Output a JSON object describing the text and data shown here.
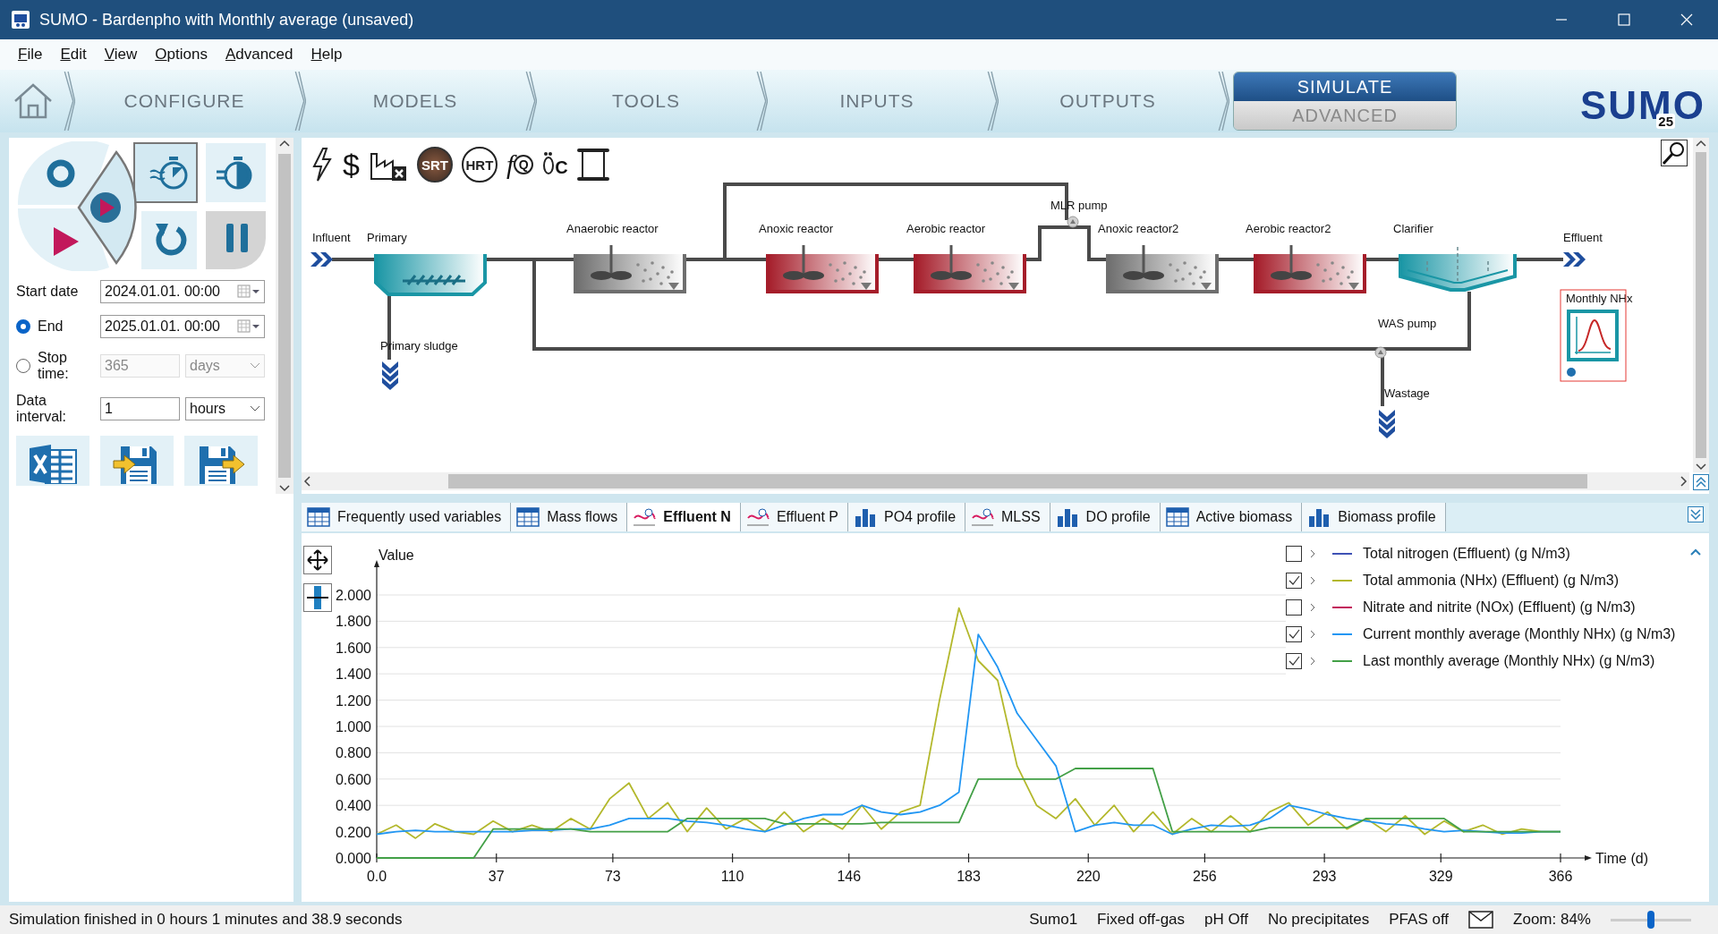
{
  "window": {
    "title": "SUMO - Bardenpho with Monthly average (unsaved)"
  },
  "menu": [
    "File",
    "Edit",
    "View",
    "Options",
    "Advanced",
    "Help"
  ],
  "nav": [
    {
      "label": "CONFIGURE",
      "selected": false
    },
    {
      "label": "MODELS",
      "selected": false
    },
    {
      "label": "TOOLS",
      "selected": false
    },
    {
      "label": "INPUTS",
      "selected": false
    },
    {
      "label": "OUTPUTS",
      "selected": false
    }
  ],
  "nav_split": [
    {
      "label": "SIMULATE",
      "selected": true
    },
    {
      "label": "ADVANCED",
      "selected": false
    }
  ],
  "logo": {
    "text": "SUMO",
    "badge": "25"
  },
  "run_panel": {
    "start_date": {
      "label": "Start date",
      "value": "2024.01.01. 00:00"
    },
    "end": {
      "label": "End",
      "value": "2025.01.01. 00:00",
      "selected": true
    },
    "stop_time": {
      "label": "Stop time:",
      "value": "365",
      "unit": "days",
      "selected": false
    },
    "data_interval": {
      "label": "Data interval:",
      "value": "1",
      "unit": "hours"
    }
  },
  "diagram_toolbar": [
    {
      "kind": "power"
    },
    {
      "kind": "text",
      "text": "$"
    },
    {
      "kind": "emissions"
    },
    {
      "kind": "badge",
      "text": "SRT",
      "dark": true
    },
    {
      "kind": "badge",
      "text": "HRT",
      "dark": false
    },
    {
      "kind": "function",
      "text": "f",
      "sub": "Q"
    },
    {
      "kind": "footprint",
      "text": "C"
    },
    {
      "kind": "scroll"
    }
  ],
  "diagram": {
    "elements": [
      {
        "kind": "influent",
        "label": "Influent"
      },
      {
        "kind": "primary",
        "label": "Primary"
      },
      {
        "kind": "outlet",
        "label": "Primary sludge"
      },
      {
        "kind": "reactor",
        "label": "Anaerobic reactor",
        "color": "#6e6e6e"
      },
      {
        "kind": "reactor",
        "label": "Anoxic reactor",
        "color": "#a51d2a"
      },
      {
        "kind": "reactor",
        "label": "Aerobic reactor",
        "color": "#a51d2a"
      },
      {
        "kind": "pump",
        "label": "MLR pump"
      },
      {
        "kind": "reactor",
        "label": "Anoxic reactor2",
        "color": "#6e6e6e"
      },
      {
        "kind": "reactor",
        "label": "Aerobic reactor2",
        "color": "#a51d2a"
      },
      {
        "kind": "clarifier",
        "label": "Clarifier"
      },
      {
        "kind": "effluent",
        "label": "Effluent"
      },
      {
        "kind": "pump",
        "label": "WAS pump"
      },
      {
        "kind": "outlet",
        "label": "Wastage"
      },
      {
        "kind": "monitor",
        "label": "Monthly NHx",
        "selected": true
      }
    ]
  },
  "chart_tabs": [
    {
      "label": "Frequently used variables",
      "kind": "table",
      "selected": false
    },
    {
      "label": "Mass flows",
      "kind": "table",
      "selected": false
    },
    {
      "label": "Effluent N",
      "kind": "timeseries",
      "selected": true
    },
    {
      "label": "Effluent P",
      "kind": "timeseries",
      "selected": false
    },
    {
      "label": "PO4 profile",
      "kind": "bars",
      "selected": false
    },
    {
      "label": "MLSS",
      "kind": "timeseries",
      "selected": false
    },
    {
      "label": "DO profile",
      "kind": "bars",
      "selected": false
    },
    {
      "label": "Active biomass",
      "kind": "table",
      "selected": false
    },
    {
      "label": "Biomass profile",
      "kind": "bars",
      "selected": false
    }
  ],
  "chart_data": {
    "type": "line",
    "xlabel": "Time  (d)",
    "ylabel": "Value",
    "xlim": [
      0,
      366
    ],
    "ylim": [
      0,
      2
    ],
    "xticks": [
      {
        "value": 0,
        "label": "0.0"
      },
      37,
      73,
      110,
      146,
      183,
      220,
      256,
      293,
      329,
      366
    ],
    "yticks": [
      {
        "value": 0,
        "label": "0.000"
      },
      {
        "value": 0.2,
        "label": "0.200"
      },
      {
        "value": 0.4,
        "label": "0.400"
      },
      {
        "value": 0.6,
        "label": "0.600"
      },
      {
        "value": 0.8,
        "label": "0.800"
      },
      {
        "value": 1,
        "label": "1.000"
      },
      {
        "value": 1.2,
        "label": "1.200"
      },
      {
        "value": 1.4,
        "label": "1.400"
      },
      {
        "value": 1.6,
        "label": "1.600"
      },
      {
        "value": 1.8,
        "label": "1.800"
      },
      {
        "value": 2,
        "label": "2.000"
      }
    ],
    "x": [
      0,
      6,
      12,
      18,
      24,
      30,
      36,
      42,
      48,
      54,
      60,
      66,
      72,
      78,
      84,
      90,
      96,
      102,
      108,
      114,
      120,
      126,
      132,
      138,
      144,
      150,
      156,
      162,
      168,
      174,
      180,
      186,
      192,
      198,
      204,
      210,
      216,
      222,
      228,
      234,
      240,
      246,
      252,
      258,
      264,
      270,
      276,
      282,
      288,
      294,
      300,
      306,
      312,
      318,
      324,
      330,
      336,
      342,
      348,
      354,
      360,
      366
    ],
    "grid": true,
    "series": [
      {
        "name": "Total nitrogen (Effluent) (g N/m3)",
        "color": "#3f51b5",
        "values": [
          null,
          null,
          null,
          null,
          null,
          null,
          null,
          null,
          null,
          null,
          null,
          null,
          null,
          null,
          null,
          null,
          null,
          null,
          null,
          null,
          null,
          null,
          null,
          null,
          null,
          null,
          null,
          null,
          null,
          null,
          null,
          null,
          null,
          null,
          null,
          null,
          null,
          null,
          null,
          null,
          null,
          null,
          null,
          null,
          null,
          null,
          null,
          null,
          null,
          null,
          null,
          null,
          null,
          null,
          null,
          null,
          null,
          null,
          null,
          null,
          null,
          null
        ]
      },
      {
        "name": "Total ammonia (NHx) (Effluent) (g N/m3)",
        "color": "#b3b82c",
        "values": [
          0.18,
          0.25,
          0.15,
          0.26,
          0.2,
          0.18,
          0.28,
          0.2,
          0.25,
          0.2,
          0.3,
          0.22,
          0.45,
          0.57,
          0.3,
          0.42,
          0.2,
          0.38,
          0.22,
          0.3,
          0.2,
          0.35,
          0.2,
          0.3,
          0.22,
          0.4,
          0.22,
          0.35,
          0.4,
          1.2,
          1.9,
          1.5,
          1.35,
          0.7,
          0.4,
          0.3,
          0.45,
          0.25,
          0.4,
          0.2,
          0.35,
          0.18,
          0.3,
          0.2,
          0.32,
          0.2,
          0.35,
          0.42,
          0.25,
          0.35,
          0.22,
          0.3,
          0.2,
          0.32,
          0.18,
          0.28,
          0.2,
          0.25,
          0.18,
          0.22,
          0.2,
          0.2
        ]
      },
      {
        "name": "Nitrate and nitrite (NOx) (Effluent) (g N/m3)",
        "color": "#c2185b",
        "values": [
          null,
          null,
          null,
          null,
          null,
          null,
          null,
          null,
          null,
          null,
          null,
          null,
          null,
          null,
          null,
          null,
          null,
          null,
          null,
          null,
          null,
          null,
          null,
          null,
          null,
          null,
          null,
          null,
          null,
          null,
          null,
          null,
          null,
          null,
          null,
          null,
          null,
          null,
          null,
          null,
          null,
          null,
          null,
          null,
          null,
          null,
          null,
          null,
          null,
          null,
          null,
          null,
          null,
          null,
          null,
          null,
          null,
          null,
          null,
          null,
          null,
          null
        ]
      },
      {
        "name": "Current monthly average (Monthly NHx) (g N/m3)",
        "color": "#2196f3",
        "values": [
          0.18,
          0.2,
          0.21,
          0.2,
          0.2,
          0.2,
          0.2,
          0.2,
          0.21,
          0.21,
          0.22,
          0.22,
          0.25,
          0.3,
          0.3,
          0.3,
          0.28,
          0.27,
          0.25,
          0.22,
          0.2,
          0.25,
          0.3,
          0.33,
          0.33,
          0.4,
          0.35,
          0.33,
          0.35,
          0.4,
          0.5,
          1.7,
          1.45,
          1.1,
          0.9,
          0.7,
          0.2,
          0.25,
          0.27,
          0.25,
          0.25,
          0.18,
          0.22,
          0.25,
          0.24,
          0.25,
          0.3,
          0.4,
          0.37,
          0.33,
          0.3,
          0.28,
          0.26,
          0.25,
          0.22,
          0.2,
          0.21,
          0.2,
          0.19,
          0.19,
          0.2,
          0.2
        ]
      },
      {
        "name": "Last monthly average (Monthly NHx) (g N/m3)",
        "color": "#43a047",
        "values": [
          0,
          0,
          0,
          0,
          0,
          0,
          0.22,
          0.22,
          0.22,
          0.22,
          0.22,
          0.2,
          0.2,
          0.2,
          0.2,
          0.2,
          0.3,
          0.3,
          0.3,
          0.3,
          0.3,
          0.26,
          0.26,
          0.26,
          0.26,
          0.26,
          0.27,
          0.27,
          0.27,
          0.27,
          0.27,
          0.6,
          0.6,
          0.6,
          0.6,
          0.6,
          0.68,
          0.68,
          0.68,
          0.68,
          0.68,
          0.2,
          0.2,
          0.2,
          0.2,
          0.2,
          0.23,
          0.23,
          0.23,
          0.23,
          0.23,
          0.3,
          0.3,
          0.3,
          0.3,
          0.3,
          0.2,
          0.2,
          0.2,
          0.2,
          0.2,
          0.2
        ]
      }
    ]
  },
  "legend": [
    {
      "checked": false
    },
    {
      "checked": true
    },
    {
      "checked": false
    },
    {
      "checked": true
    },
    {
      "checked": true
    }
  ],
  "status_bar": {
    "message": "Simulation finished in 0 hours 1 minutes and 38.9 seconds",
    "items": [
      "Sumo1",
      "Fixed off-gas",
      "pH Off",
      "No precipitates",
      "PFAS off"
    ],
    "zoom": {
      "label": "Zoom: 84%",
      "level": 0.5
    }
  }
}
